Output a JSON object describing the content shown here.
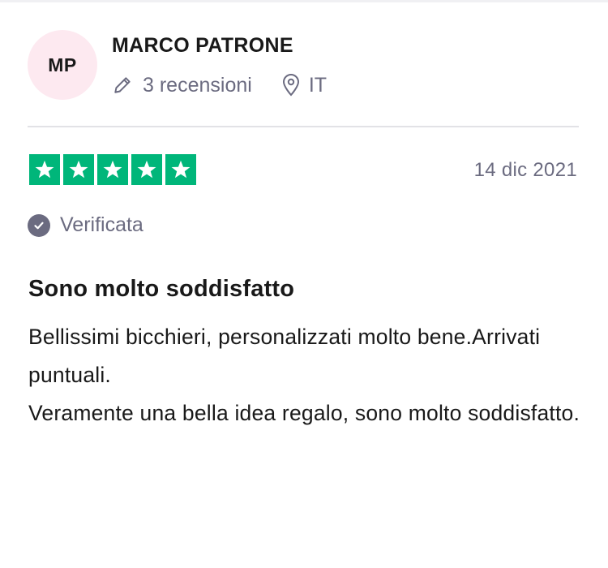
{
  "reviewer": {
    "initials": "MP",
    "name": "MARCO PATRONE",
    "reviews_count": "3 recensioni",
    "country": "IT",
    "avatar_color": "#fde9f0"
  },
  "review": {
    "rating": 5,
    "rating_color": "#00b67a",
    "date": "14 dic 2021",
    "verified_label": "Verificata",
    "title": "Sono molto soddisfatto",
    "body_lines": [
      "Bellissimi bicchieri, personalizzati molto bene.Arrivati puntuali.",
      "Veramente una bella idea regalo, sono molto soddisfatto."
    ]
  },
  "icons": {
    "reviews": "pencil-icon",
    "location": "location-pin-icon",
    "verified": "check-circle-icon",
    "star": "star-icon"
  }
}
